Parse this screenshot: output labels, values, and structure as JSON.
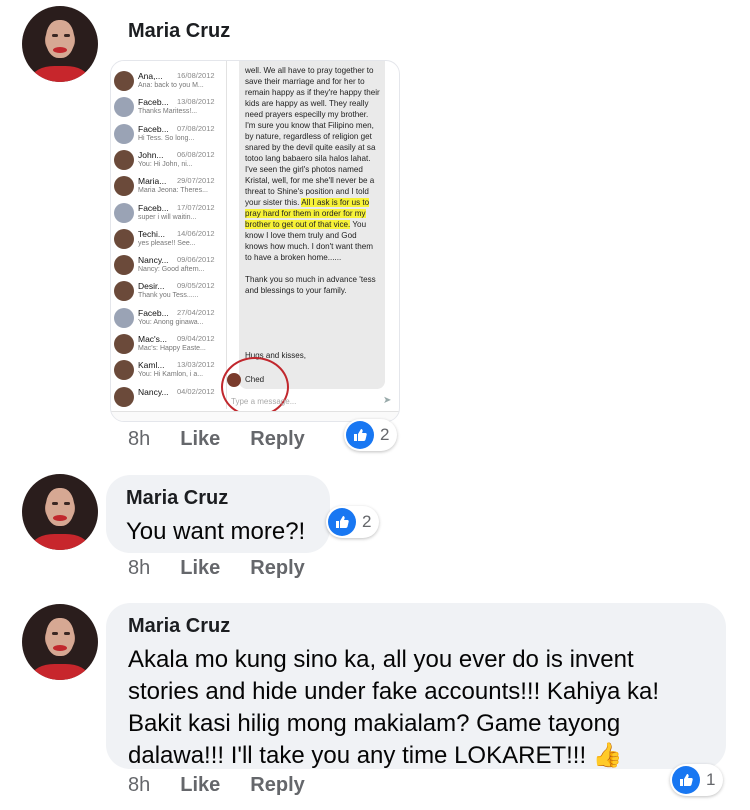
{
  "comments": [
    {
      "author": "Maria Cruz",
      "time": "8h",
      "like_label": "Like",
      "reply_label": "Reply",
      "reaction_count": "2"
    },
    {
      "author": "Maria Cruz",
      "text": "You want more?!",
      "time": "8h",
      "like_label": "Like",
      "reply_label": "Reply",
      "reaction_count": "2"
    },
    {
      "author": "Maria Cruz",
      "text": "Akala mo kung sino ka, all you ever do is invent stories and hide under fake accounts!!!  Kahiya ka! Bakit kasi hilig mong makialam? Game tayong dalawa!!! I'll take you any time LOKARET!!! 👍",
      "time": "8h",
      "like_label": "Like",
      "reply_label": "Reply",
      "reaction_count": "1"
    }
  ],
  "screenshot": {
    "conversations": [
      {
        "name": "Ana,...",
        "date": "16/08/2012",
        "preview": "Ana: back to you M..."
      },
      {
        "name": "Faceb...",
        "date": "13/08/2012",
        "preview": "Thanks Maritess!..."
      },
      {
        "name": "Faceb...",
        "date": "07/08/2012",
        "preview": "Hi Tess. So long..."
      },
      {
        "name": "John...",
        "date": "06/08/2012",
        "preview": "You: Hi John, ni..."
      },
      {
        "name": "Maria...",
        "date": "29/07/2012",
        "preview": "Maria Jeona: Theres..."
      },
      {
        "name": "Faceb...",
        "date": "17/07/2012",
        "preview": "super i will waitin..."
      },
      {
        "name": "Techi...",
        "date": "14/06/2012",
        "preview": "yes please!! See..."
      },
      {
        "name": "Nancy...",
        "date": "09/06/2012",
        "preview": "Nancy: Good aftern..."
      },
      {
        "name": "Desir...",
        "date": "09/05/2012",
        "preview": "Thank you Tess......"
      },
      {
        "name": "Faceb...",
        "date": "27/04/2012",
        "preview": "You: Anong ginawa..."
      },
      {
        "name": "Mac's...",
        "date": "09/04/2012",
        "preview": "Mac's: Happy Easte..."
      },
      {
        "name": "Kaml...",
        "date": "13/03/2012",
        "preview": "You: Hi Kamlon, i a..."
      },
      {
        "name": "Nancy...",
        "date": "04/02/2012",
        "preview": ""
      }
    ],
    "message_intro": "well. We all have to pray together to save their marriage and for her to remain happy as if they're happy their kids are happy as well. They really need prayers especilly my brother. I'm sure you know that Filipino men, by nature, regardless of religion get snared by the devil quite easily at sa totoo lang babaero sila halos lahat. I've seen  the girl's photos named Kristal, well, for me she'll never be a threat to Shine's position and I told your sister this.",
    "message_highlight": "All I ask is for us to pray hard for them in order for my brother to get out of that vice.",
    "message_rest": "You know I love them truly and God knows how much. I don't want them to have a broken home......",
    "message_thanks": "Thank you so much in advance 'tess and blessings to your family.",
    "signoff": "Hugs and kisses,",
    "sender": "Ched",
    "input_placeholder": "Type a message..."
  }
}
